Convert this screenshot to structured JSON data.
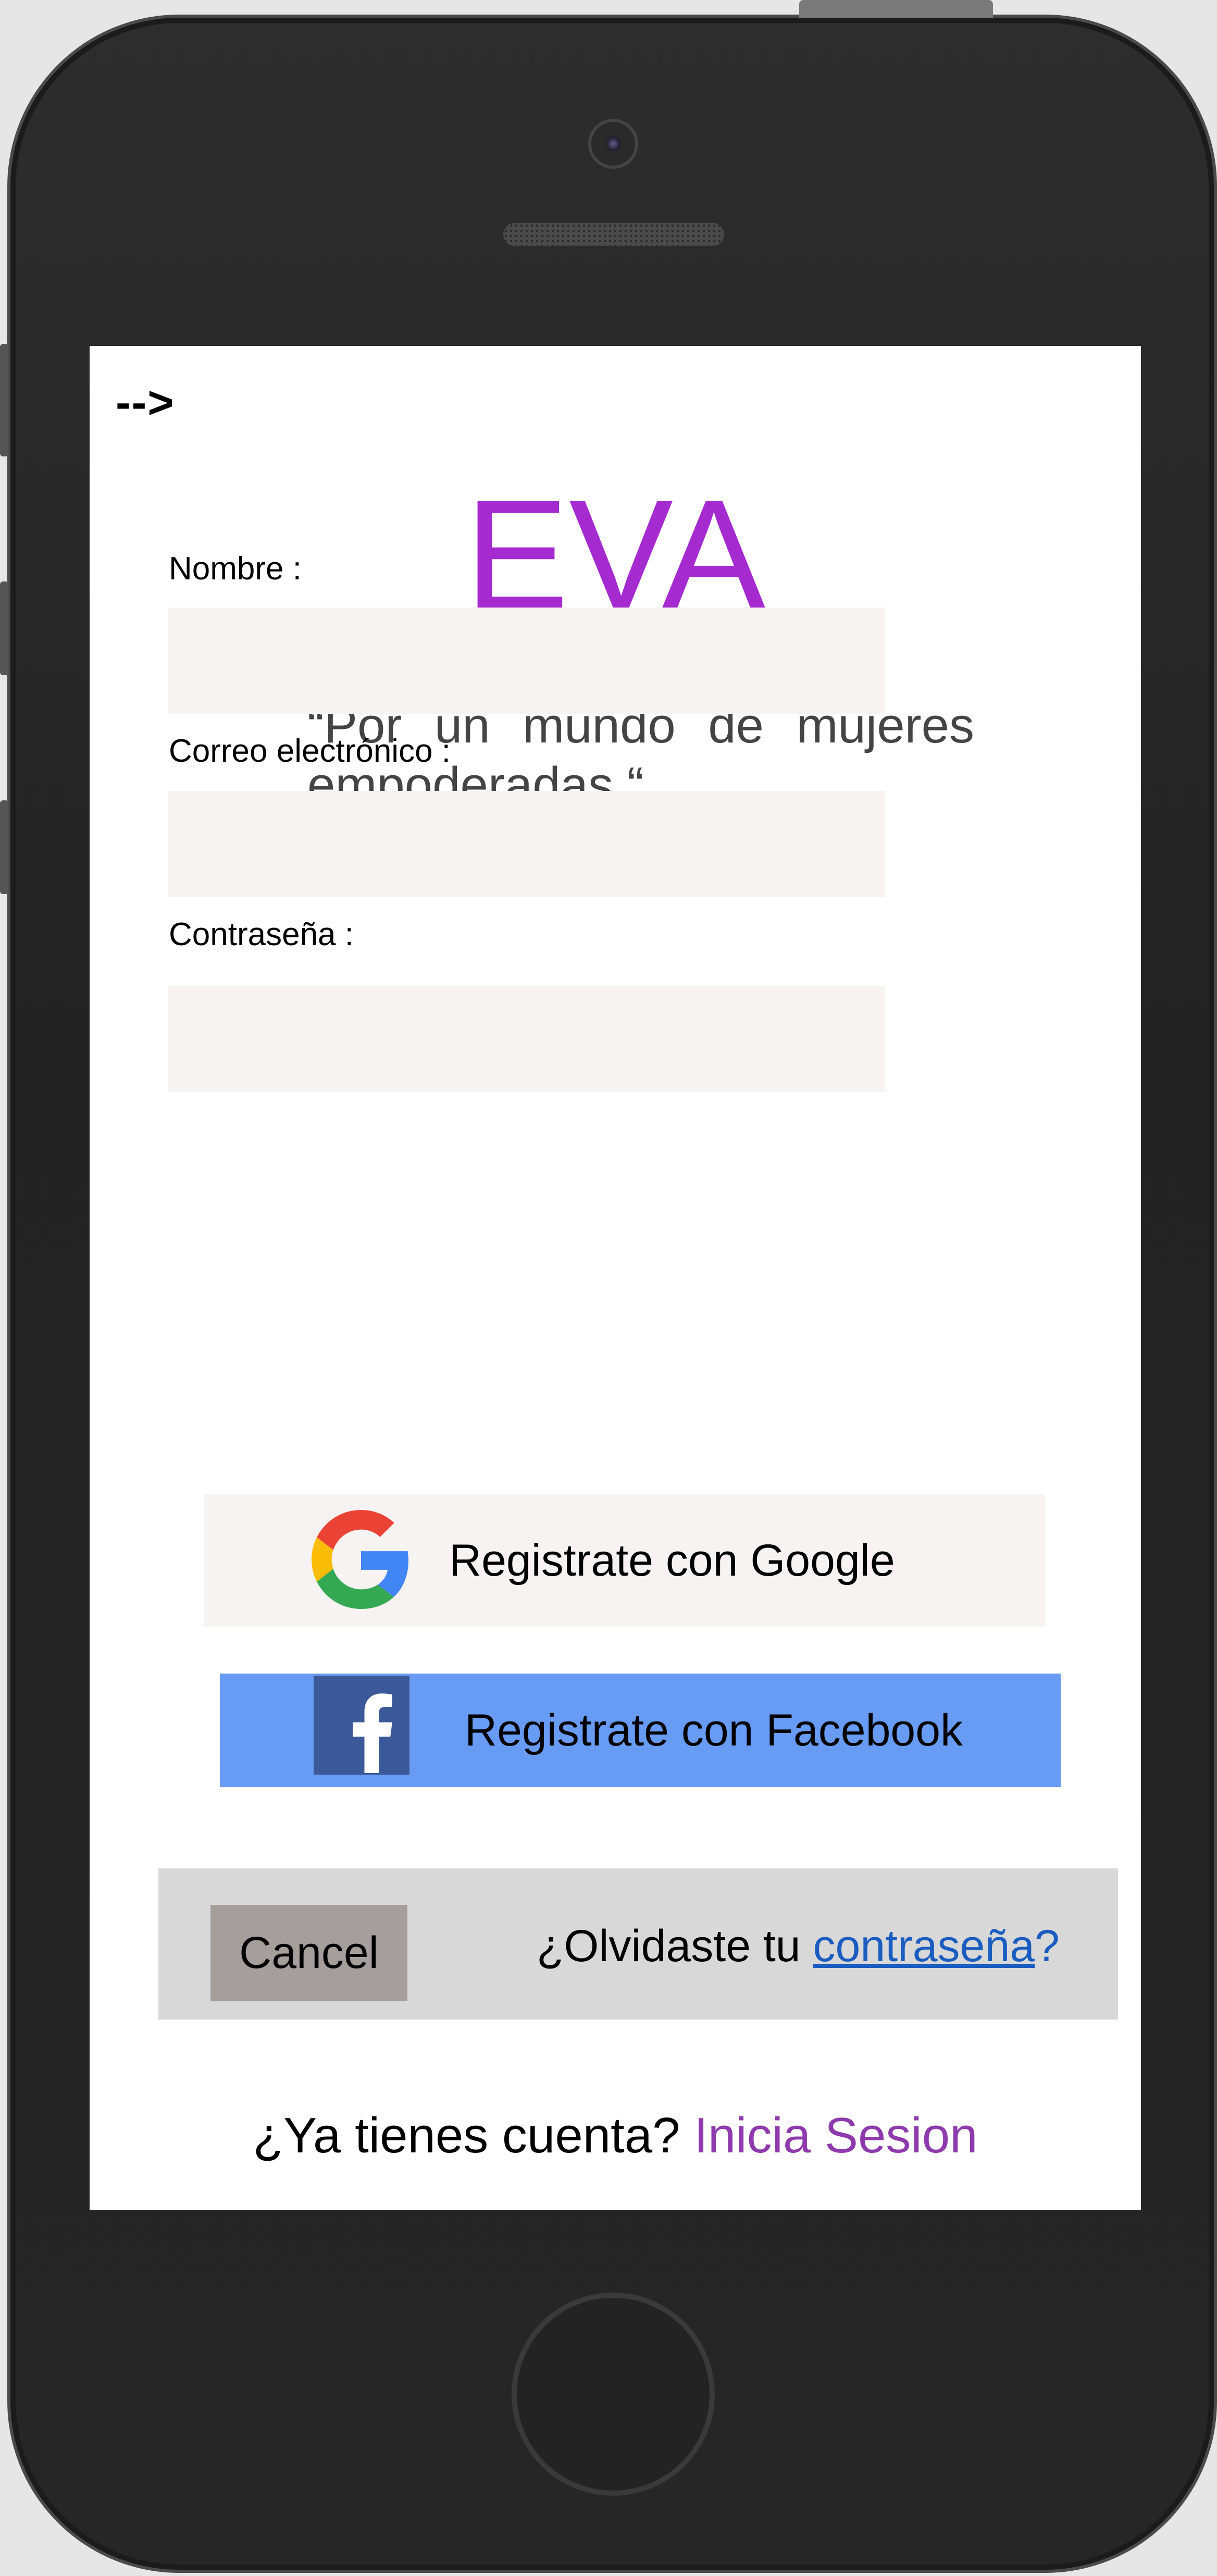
{
  "screen": {
    "arrow_text": "-->",
    "brand": "EVA",
    "tagline": "“Por un mundo de mujeres empoderadas “.",
    "form": {
      "name_label": "Nombre :",
      "email_label": "Correo electrónico :",
      "password_label": "Contraseña :",
      "name_value": "",
      "email_value": "",
      "password_value": ""
    },
    "google_button": {
      "label": "Registrate con Google",
      "icon": "google-icon"
    },
    "facebook_button": {
      "label": "Registrate con Facebook",
      "icon": "facebook-icon"
    },
    "bottom_bar": {
      "cancel_label": "Cancel",
      "forgot_prefix": "¿Olvidaste tu ",
      "forgot_link": "contraseña",
      "forgot_suffix": "?"
    },
    "footer": {
      "question": "¿Ya tienes cuenta? ",
      "login_link": "Inicia Sesion"
    }
  },
  "colors": {
    "brand": "#a52bd0",
    "facebook": "#689cf4",
    "link": "#1a5cc0",
    "login_link": "#8e3aae"
  }
}
